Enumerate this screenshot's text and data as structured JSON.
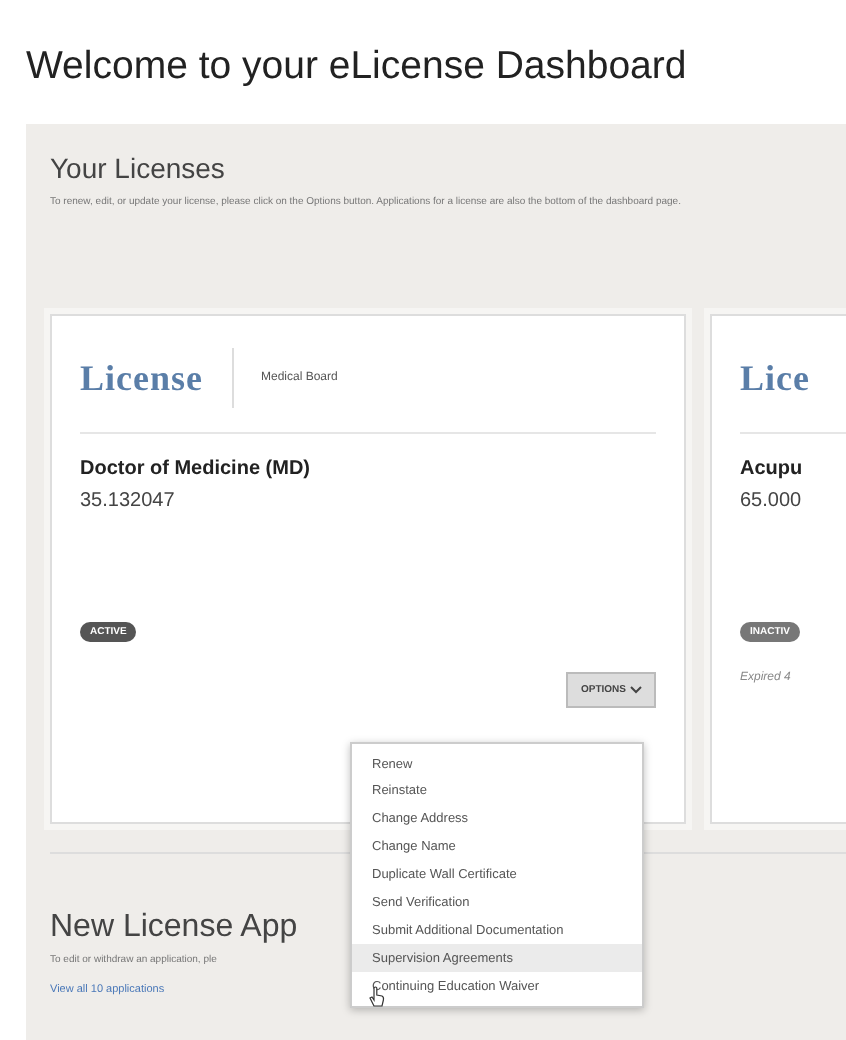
{
  "page_title": "Welcome to your eLicense Dashboard",
  "licenses_section": {
    "heading": "Your Licenses",
    "description": "To renew, edit, or update your license, please click on the Options button. Applications for a license are also the bottom of the dashboard page."
  },
  "license_cards": [
    {
      "logo": "License",
      "board": "Medical Board",
      "name": "Doctor of Medicine (MD)",
      "number": "35.132047",
      "status": "ACTIVE",
      "kind": "active",
      "options_button": "OPTIONS"
    },
    {
      "logo": "Lice",
      "name": "Acupu",
      "number": "65.000",
      "status": "INACTIV",
      "kind": "inactive",
      "note": "Expired 4"
    }
  ],
  "options_menu": {
    "items": [
      {
        "label": "Renew",
        "selected": false
      },
      {
        "label": "Reinstate",
        "selected": false
      },
      {
        "label": "Change Address",
        "selected": false
      },
      {
        "label": "Change Name",
        "selected": false
      },
      {
        "label": "Duplicate Wall Certificate",
        "selected": false
      },
      {
        "label": "Send Verification",
        "selected": false
      },
      {
        "label": "Submit Additional Documentation",
        "selected": false
      },
      {
        "label": "Supervision Agreements",
        "selected": true
      },
      {
        "label": "Continuing Education Waiver",
        "selected": false
      }
    ]
  },
  "applications_section": {
    "heading": "New License App",
    "description": "To edit or withdraw an application, ple",
    "link": "View all 10 applications"
  }
}
